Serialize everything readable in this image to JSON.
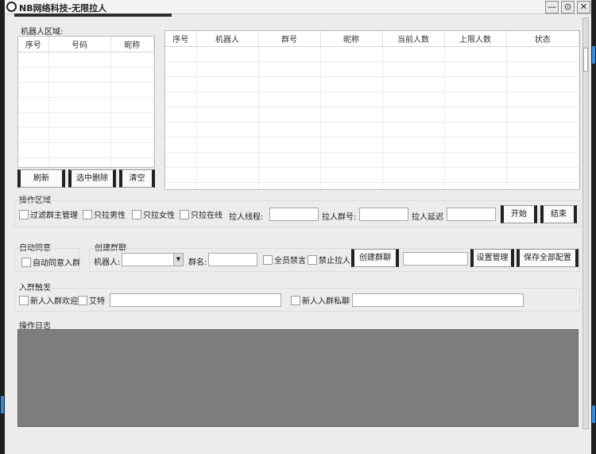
{
  "window": {
    "title": "NB网络科技-无限拉人"
  },
  "controls": {
    "minimize": "—",
    "restore": "⊙",
    "close": "✕"
  },
  "robot_area": {
    "label": "机器人区域:",
    "columns": [
      "序号",
      "号码",
      "昵称"
    ],
    "buttons": {
      "refresh": "刷新",
      "delete_selected": "选中删除",
      "clear": "清空"
    }
  },
  "group_table": {
    "columns": [
      "序号",
      "机器人",
      "群号",
      "昵称",
      "当前人数",
      "上限人数",
      "状态"
    ]
  },
  "operation": {
    "label": "操作区域",
    "checks": [
      "过滤群主管理",
      "只拉男性",
      "只拉女性",
      "只拉在线"
    ],
    "threads_label": "拉人线程:",
    "group_no_label": "拉人群号:",
    "delay_label": "拉人延迟",
    "start": "开始",
    "stop": "结束"
  },
  "auto_agree": {
    "label": "自动同意",
    "check": "自动同意入群"
  },
  "create_group": {
    "label": "创建群聊",
    "robot_label": "机器人:",
    "name_label": "群名:",
    "mute_all": "全员禁言",
    "no_invite": "禁止拉人",
    "create": "创建群聊",
    "settings": "设置管理",
    "save_all": "保存全部配置"
  },
  "join_trigger": {
    "label": "入群触发",
    "welcome": "新人入群欢迎",
    "at": "艾特",
    "private": "新人入群私聊"
  },
  "log": {
    "label": "操作日志"
  }
}
